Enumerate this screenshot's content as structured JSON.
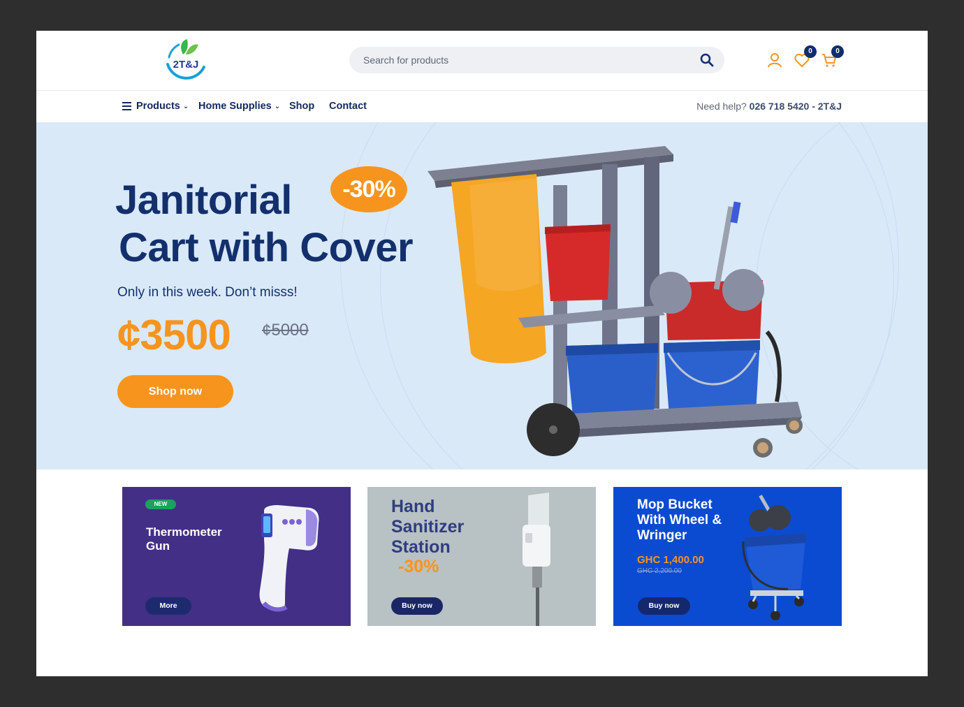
{
  "header": {
    "logo_text": "2T&J",
    "search_placeholder": "Search for products",
    "wishlist_count": "0",
    "cart_count": "0"
  },
  "nav": {
    "items": [
      {
        "label": "Products",
        "has_dropdown": true
      },
      {
        "label": "Home Supplies",
        "has_dropdown": true
      },
      {
        "label": "Shop",
        "has_dropdown": false
      },
      {
        "label": "Contact",
        "has_dropdown": false
      }
    ],
    "help_label": "Need help?",
    "help_phone": "026 718 5420 - 2T&J"
  },
  "hero": {
    "title_line1": "Janitorial",
    "title_line2": "Cart with Cover",
    "discount": "-30%",
    "subtitle": "Only in this week. Don’t misss!",
    "price": "¢3500",
    "old_price": "¢5000",
    "cta": "Shop now"
  },
  "promos": [
    {
      "tag": "NEW",
      "title": "Thermometer Gun",
      "button": "More"
    },
    {
      "title": "Hand Sanitizer Station",
      "discount": "-30%",
      "button": "Buy now"
    },
    {
      "title": "Mop Bucket With Wheel & Wringer",
      "price": "GHC 1,400.00",
      "old_price": "GHC 2,200.00",
      "button": "Buy now"
    }
  ],
  "colors": {
    "brand_navy": "#13306d",
    "accent_orange": "#f7941d",
    "hero_bg": "#d9e9f8"
  }
}
